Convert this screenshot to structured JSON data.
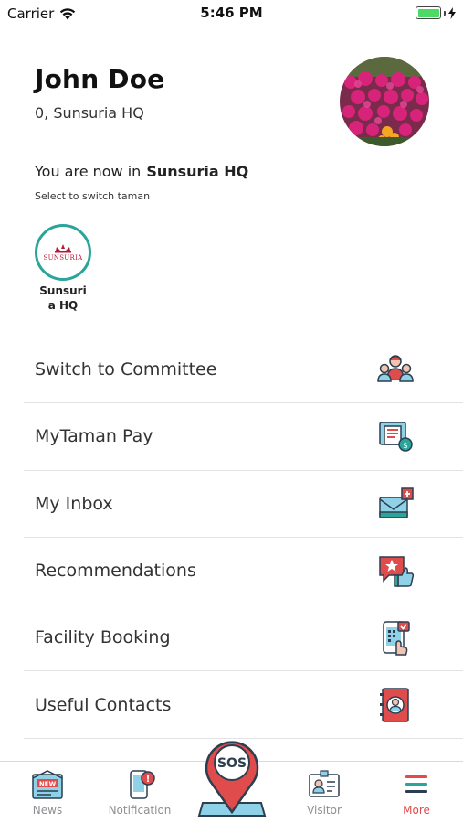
{
  "status_bar": {
    "carrier": "Carrier",
    "time": "5:46 PM",
    "battery_level": 1.0,
    "battery_color": "#4cd964"
  },
  "profile": {
    "name": "John Doe",
    "address": "0, Sunsuria HQ",
    "avatar_icon": "flower-garden-photo"
  },
  "location": {
    "prefix": "You are now in",
    "current": "Sunsuria HQ",
    "hint": "Select to switch taman"
  },
  "tamans": [
    {
      "label": "Sunsuria HQ",
      "logo_text": "SUNSURIA"
    }
  ],
  "menu": [
    {
      "label": "Switch to Committee",
      "icon": "committee-icon"
    },
    {
      "label": "MyTaman Pay",
      "icon": "pay-icon"
    },
    {
      "label": "My Inbox",
      "icon": "inbox-icon"
    },
    {
      "label": "Recommendations",
      "icon": "recommendation-icon"
    },
    {
      "label": "Facility Booking",
      "icon": "booking-icon"
    },
    {
      "label": "Useful Contacts",
      "icon": "contacts-icon"
    }
  ],
  "tab_bar": {
    "tabs": [
      {
        "label": "News",
        "icon": "news-icon"
      },
      {
        "label": "Notification",
        "icon": "notification-icon"
      },
      {
        "label": "Visitor",
        "icon": "visitor-icon"
      },
      {
        "label": "More",
        "icon": "menu-icon",
        "active": true
      }
    ],
    "sos_label": "SOS",
    "active_color": "#e04c4c",
    "inactive_color": "#8e8e93"
  },
  "colors": {
    "teal": "#2aa59a",
    "red": "#e04c4c",
    "navy": "#2c3e50"
  }
}
